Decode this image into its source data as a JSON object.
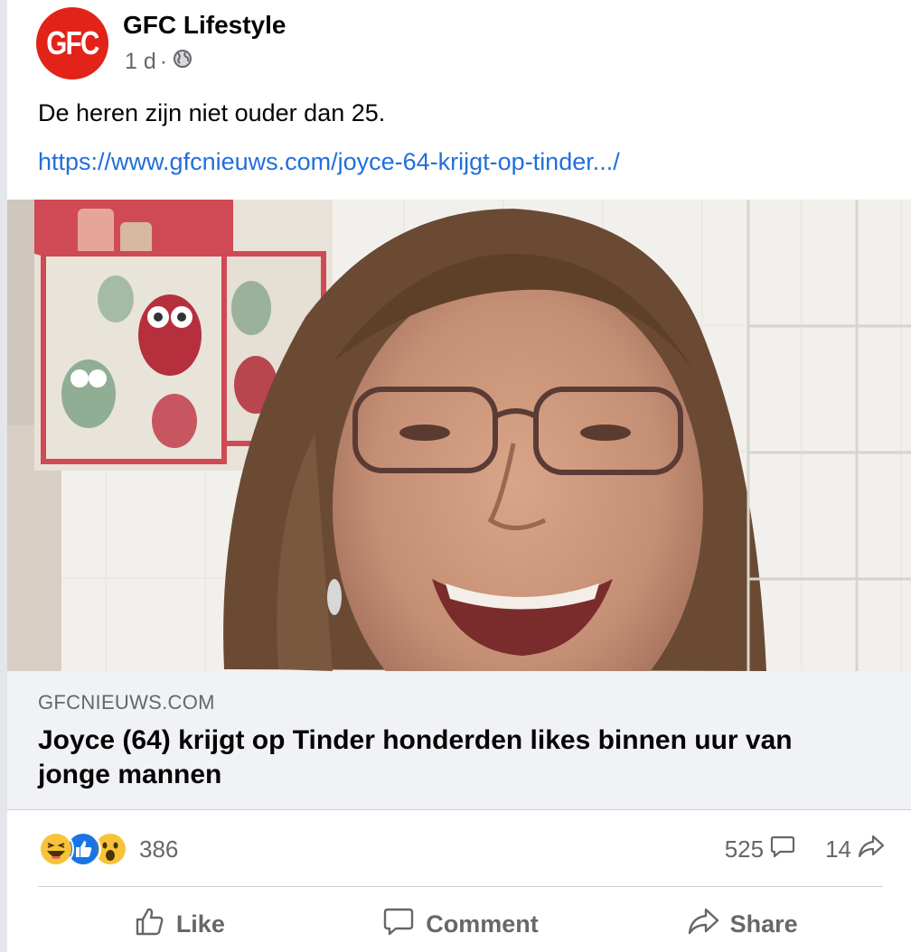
{
  "post": {
    "page_name": "GFC Lifestyle",
    "avatar_text": "GFC",
    "time": "1 d",
    "separator": "·",
    "audience_icon": "globe-icon",
    "text": "De heren zijn niet ouder dan 25.",
    "link": "https://www.gfcnieuws.com/joyce-64-krijgt-op-tinder.../"
  },
  "preview": {
    "domain": "GFCNIEUWS.COM",
    "title": "Joyce (64) krijgt op Tinder honderden likes binnen uur van jonge mannen"
  },
  "stats": {
    "reaction_icons": [
      "haha-icon",
      "like-icon",
      "wow-icon"
    ],
    "reactions_count": "386",
    "comments_count": "525",
    "shares_count": "14"
  },
  "actions": {
    "like": "Like",
    "comment": "Comment",
    "share": "Share"
  },
  "colors": {
    "brand_red": "#e2231a",
    "link_blue": "#216fdb",
    "secondary_text": "#65676b",
    "preview_bg": "#f0f2f5"
  }
}
